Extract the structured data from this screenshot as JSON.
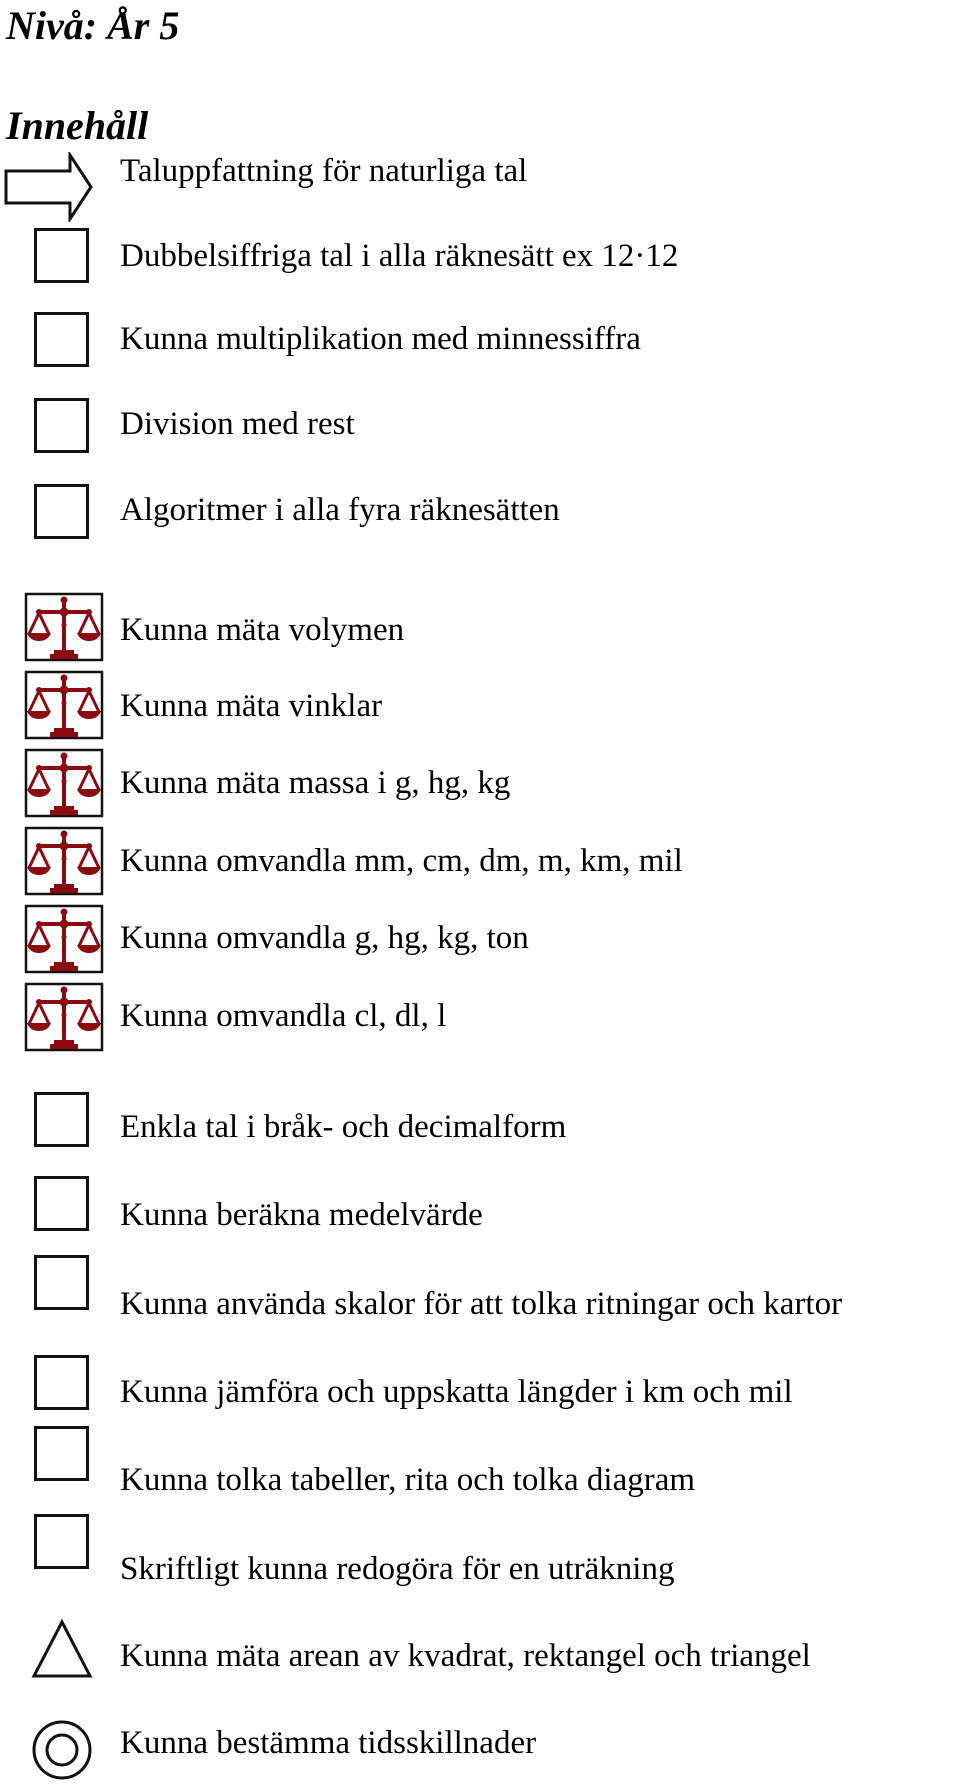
{
  "title": "Nivå: År 5",
  "section_heading": "Innehåll",
  "items": [
    {
      "marker": "arrow-icon",
      "text": "Taluppfattning för naturliga tal"
    },
    {
      "marker": "checkbox",
      "text": "Dubbelsiffriga tal i alla räknesätt ex 12·12"
    },
    {
      "marker": "checkbox",
      "text": "Kunna multiplikation med minnessiffra"
    },
    {
      "marker": "checkbox",
      "text": "Division med rest"
    },
    {
      "marker": "checkbox",
      "text": "Algoritmer i alla fyra räknesätten"
    },
    {
      "marker": "scales-icon",
      "text": "Kunna mäta volymen"
    },
    {
      "marker": "scales-icon",
      "text": "Kunna mäta vinklar"
    },
    {
      "marker": "scales-icon",
      "text": "Kunna mäta massa i g, hg, kg"
    },
    {
      "marker": "scales-icon",
      "text": "Kunna omvandla mm, cm, dm, m, km, mil"
    },
    {
      "marker": "scales-icon",
      "text": "Kunna omvandla g, hg, kg, ton"
    },
    {
      "marker": "scales-icon",
      "text": "Kunna omvandla cl, dl, l"
    },
    {
      "marker": "checkbox",
      "text": "Enkla tal i bråk- och decimalform"
    },
    {
      "marker": "checkbox",
      "text": "Kunna beräkna medelvärde"
    },
    {
      "marker": "checkbox",
      "text": "Kunna använda skalor för att tolka ritningar och kartor"
    },
    {
      "marker": "checkbox",
      "text": "Kunna jämföra och uppskatta längder i km och mil"
    },
    {
      "marker": "checkbox",
      "text": "Kunna tolka tabeller, rita och tolka diagram"
    },
    {
      "marker": "checkbox",
      "text": "Skriftligt kunna redogöra för en uträkning"
    },
    {
      "marker": "triangle-icon",
      "text": "Kunna mäta arean av kvadrat, rektangel och triangel"
    },
    {
      "marker": "target-icon",
      "text": "Kunna bestämma tidsskillnader"
    }
  ],
  "colors": {
    "scales": "#8b0a10",
    "ink": "#111111"
  }
}
